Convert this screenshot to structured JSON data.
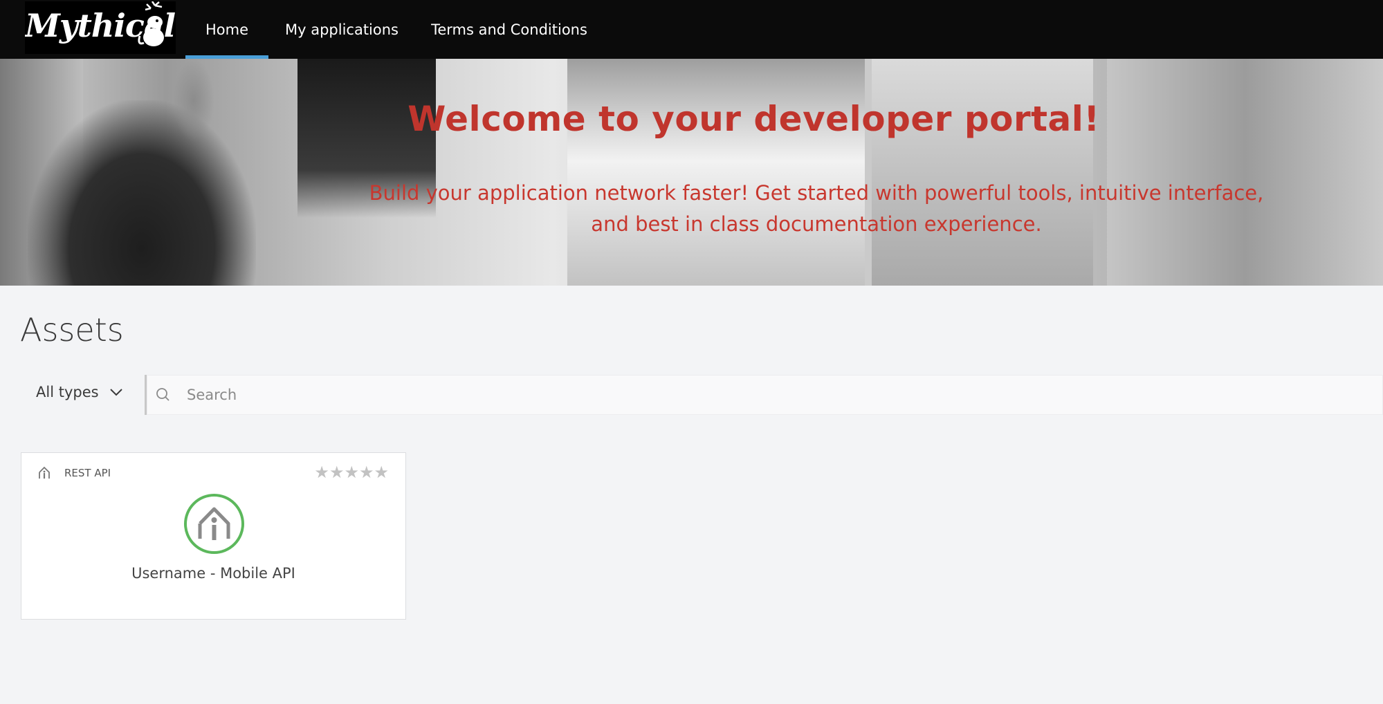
{
  "header": {
    "logo_text": "Mythical",
    "nav": [
      {
        "label": "Home",
        "active": true
      },
      {
        "label": "My applications",
        "active": false
      },
      {
        "label": "Terms and Conditions",
        "active": false
      }
    ],
    "active_indicator_color": "#4a9fd8"
  },
  "hero": {
    "title": "Welcome to your developer portal!",
    "subtitle": "Build your application network faster! Get started with powerful tools, intuitive interface, and best in class documentation experience.",
    "text_color": "#c0352d"
  },
  "assets": {
    "title": "Assets",
    "filter_label": "All types",
    "search_placeholder": "Search",
    "search_value": "",
    "cards": [
      {
        "type": "REST API",
        "type_icon": "api-icon",
        "rating_stars": 0,
        "rating_max": 5,
        "stars_display": "★★★★★",
        "name": "Username - Mobile API",
        "badge_icon": "api-icon",
        "badge_color": "#5cb85c"
      }
    ]
  }
}
